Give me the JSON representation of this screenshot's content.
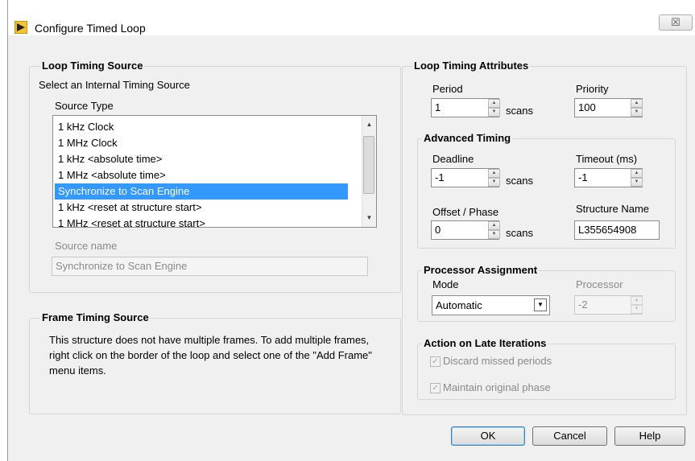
{
  "window": {
    "title": "Configure Timed Loop",
    "close_symbol": "☒"
  },
  "loop_timing_source": {
    "title": "Loop Timing Source",
    "subtitle": "Select an Internal Timing Source",
    "source_type_label": "Source Type",
    "source_types": [
      "1 kHz Clock",
      "1 MHz Clock",
      "1 kHz <absolute time>",
      "1 MHz <absolute time>",
      "Synchronize to Scan Engine",
      "1 kHz <reset at structure start>",
      "1 MHz <reset at structure start>"
    ],
    "selected_source": "Synchronize to Scan Engine",
    "source_name_label": "Source name",
    "source_name_value": "Synchronize to Scan Engine"
  },
  "frame_timing_source": {
    "title": "Frame Timing Source",
    "text": "This structure does not have multiple frames. To add multiple frames, right click on the border of the loop and select one of the \"Add Frame\" menu items."
  },
  "loop_timing_attributes": {
    "title": "Loop Timing Attributes",
    "period_label": "Period",
    "period_value": "1",
    "period_unit": "scans",
    "priority_label": "Priority",
    "priority_value": "100"
  },
  "advanced_timing": {
    "title": "Advanced Timing",
    "deadline_label": "Deadline",
    "deadline_value": "-1",
    "deadline_unit": "scans",
    "timeout_label": "Timeout (ms)",
    "timeout_value": "-1",
    "offset_label": "Offset / Phase",
    "offset_value": "0",
    "offset_unit": "scans",
    "structure_name_label": "Structure Name",
    "structure_name_value": "L355654908"
  },
  "processor_assignment": {
    "title": "Processor Assignment",
    "mode_label": "Mode",
    "mode_value": "Automatic",
    "processor_label": "Processor",
    "processor_value": "-2"
  },
  "late_iterations": {
    "title": "Action on Late Iterations",
    "discard_label": "Discard missed periods",
    "discard_checked": true,
    "maintain_label": "Maintain original phase",
    "maintain_checked": true
  },
  "buttons": {
    "ok": "OK",
    "cancel": "Cancel",
    "help": "Help"
  },
  "colors": {
    "selection": "#3399ff",
    "dialog_bg": "#f0f0f0"
  }
}
